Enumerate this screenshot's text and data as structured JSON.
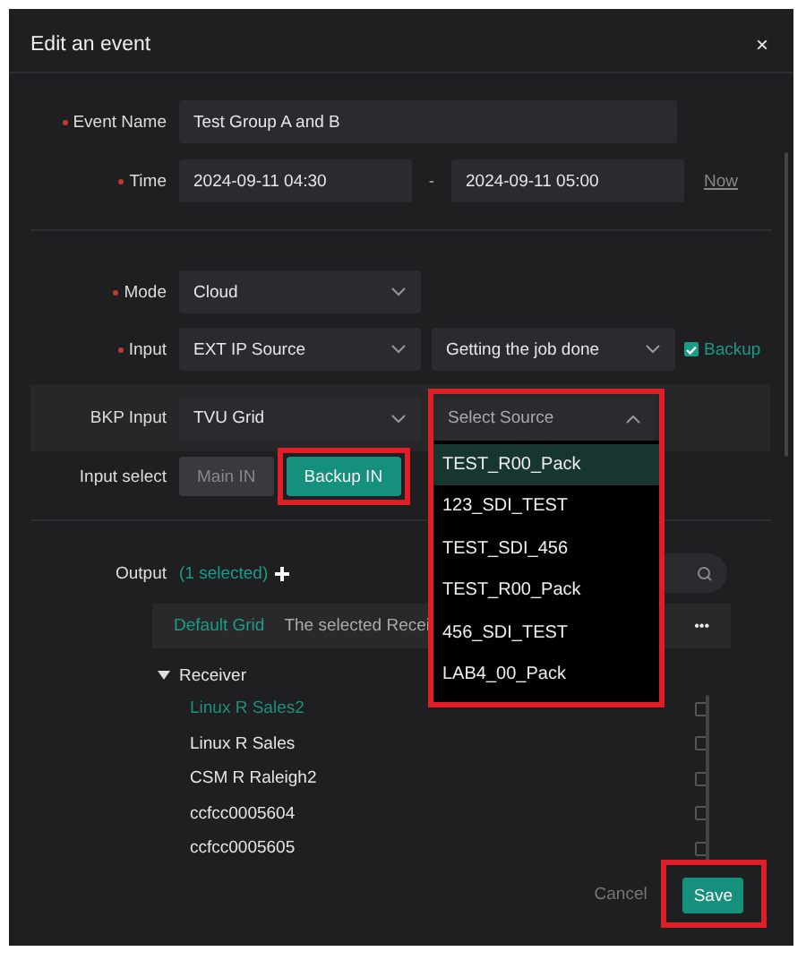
{
  "dialog": {
    "title": "Edit an event",
    "close": "×"
  },
  "fields": [
    {
      "kind": "text",
      "label": "Event Name",
      "required": true,
      "value": "Test Group A and B"
    },
    {
      "kind": "time",
      "label": "Time",
      "required": true,
      "start": "2024-09-11 04:30",
      "separator": "-",
      "end": "2024-09-11 05:00",
      "link": "Now"
    },
    {
      "kind": "select",
      "label": "Mode",
      "required": true,
      "value": "Cloud"
    },
    {
      "kind": "input",
      "label": "Input",
      "required": true,
      "value": "EXT IP Source",
      "value2": "Getting the job done",
      "backup": {
        "label": "Backup",
        "checked": true
      }
    },
    {
      "kind": "bkp",
      "label": "BKP Input",
      "required": false,
      "value": "TVU Grid",
      "source": {
        "placeholder": "Select Source",
        "expanded": true,
        "highlighted": true,
        "options": [
          {
            "label": "TEST_R00_Pack",
            "selected": true
          },
          {
            "label": "123_SDI_TEST",
            "selected": false
          },
          {
            "label": "TEST_SDI_456",
            "selected": false
          },
          {
            "label": "TEST_R00_Pack",
            "selected": false
          },
          {
            "label": "456_SDI_TEST",
            "selected": false
          },
          {
            "label": "LAB4_00_Pack",
            "selected": false
          }
        ]
      }
    },
    {
      "kind": "toggle",
      "label": "Input select",
      "required": false,
      "options": [
        {
          "label": "Main IN",
          "selected": false,
          "highlighted": false
        },
        {
          "label": "Backup IN",
          "selected": true,
          "highlighted": true
        }
      ]
    }
  ],
  "output": {
    "label": "Output",
    "count": "(1 selected)",
    "grid": "Default Grid",
    "message": "The selected Recei",
    "more": "•••",
    "group": {
      "label": "Receiver",
      "expanded": true,
      "children": [
        {
          "label": "Linux R Sales2",
          "selected": true,
          "checked": false
        },
        {
          "label": "Linux R Sales",
          "selected": false,
          "checked": false
        },
        {
          "label": "CSM R Raleigh2",
          "selected": false,
          "checked": false
        },
        {
          "label": "ccfcc0005604",
          "selected": false,
          "checked": false
        },
        {
          "label": "ccfcc0005605",
          "selected": false,
          "checked": false
        }
      ]
    }
  },
  "footer": {
    "cancel": "Cancel",
    "save": {
      "label": "Save",
      "highlighted": true
    }
  }
}
